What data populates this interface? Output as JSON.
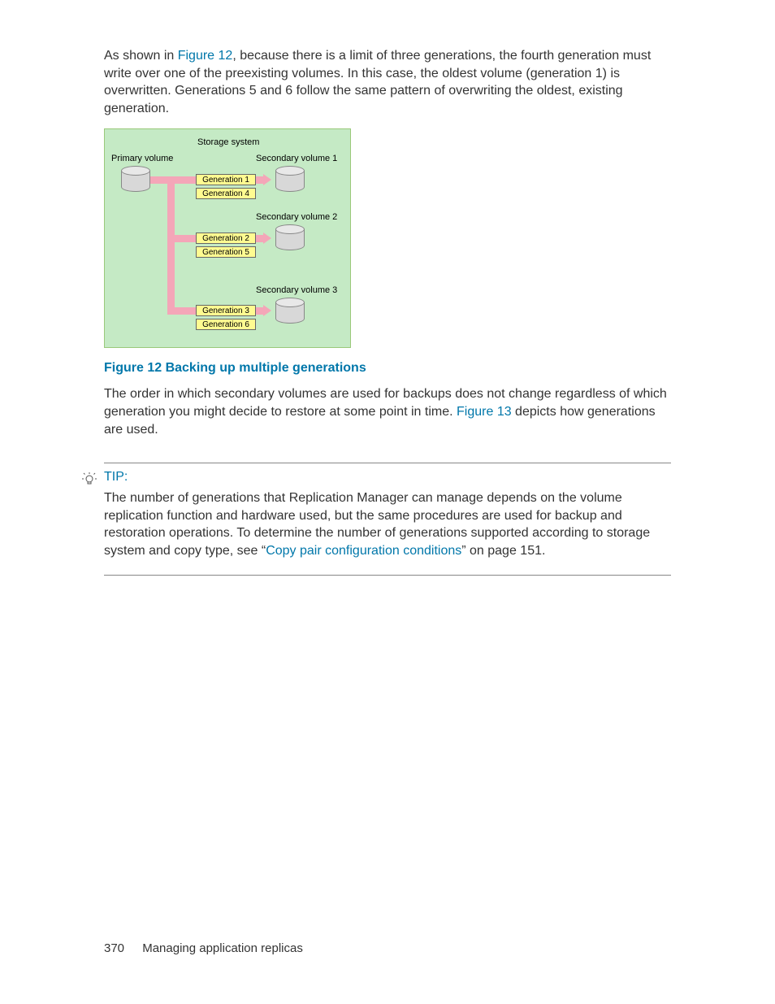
{
  "intro": {
    "pre": "As shown in ",
    "link": "Figure 12",
    "post": ", because there is a limit of three generations, the fourth generation must write over one of the preexisting volumes. In this case, the oldest volume (generation 1) is overwritten. Generations 5 and 6 follow the same pattern of overwriting the oldest, existing generation."
  },
  "diagram": {
    "title": "Storage system",
    "primary": "Primary volume",
    "sv1": "Secondary volume 1",
    "sv2": "Secondary volume 2",
    "sv3": "Secondary volume 3",
    "g1": "Generation 1",
    "g2": "Generation 2",
    "g3": "Generation 3",
    "g4": "Generation 4",
    "g5": "Generation 5",
    "g6": "Generation 6"
  },
  "figure_caption": "Figure 12 Backing up multiple generations",
  "post_figure": {
    "pre": "The order in which secondary volumes are used for backups does not change regardless of which generation you might decide to restore at some point in time. ",
    "link": "Figure 13",
    "post": " depicts how generations are used."
  },
  "tip": {
    "label": "TIP:",
    "body_pre": "The number of generations that Replication Manager can manage depends on the volume replication function and hardware used, but the same procedures are used for backup and restoration operations. To determine the number of generations supported according to storage system and copy type, see “",
    "body_link": "Copy pair configuration conditions",
    "body_post": "” on page 151."
  },
  "footer": {
    "page": "370",
    "section": "Managing application replicas"
  }
}
